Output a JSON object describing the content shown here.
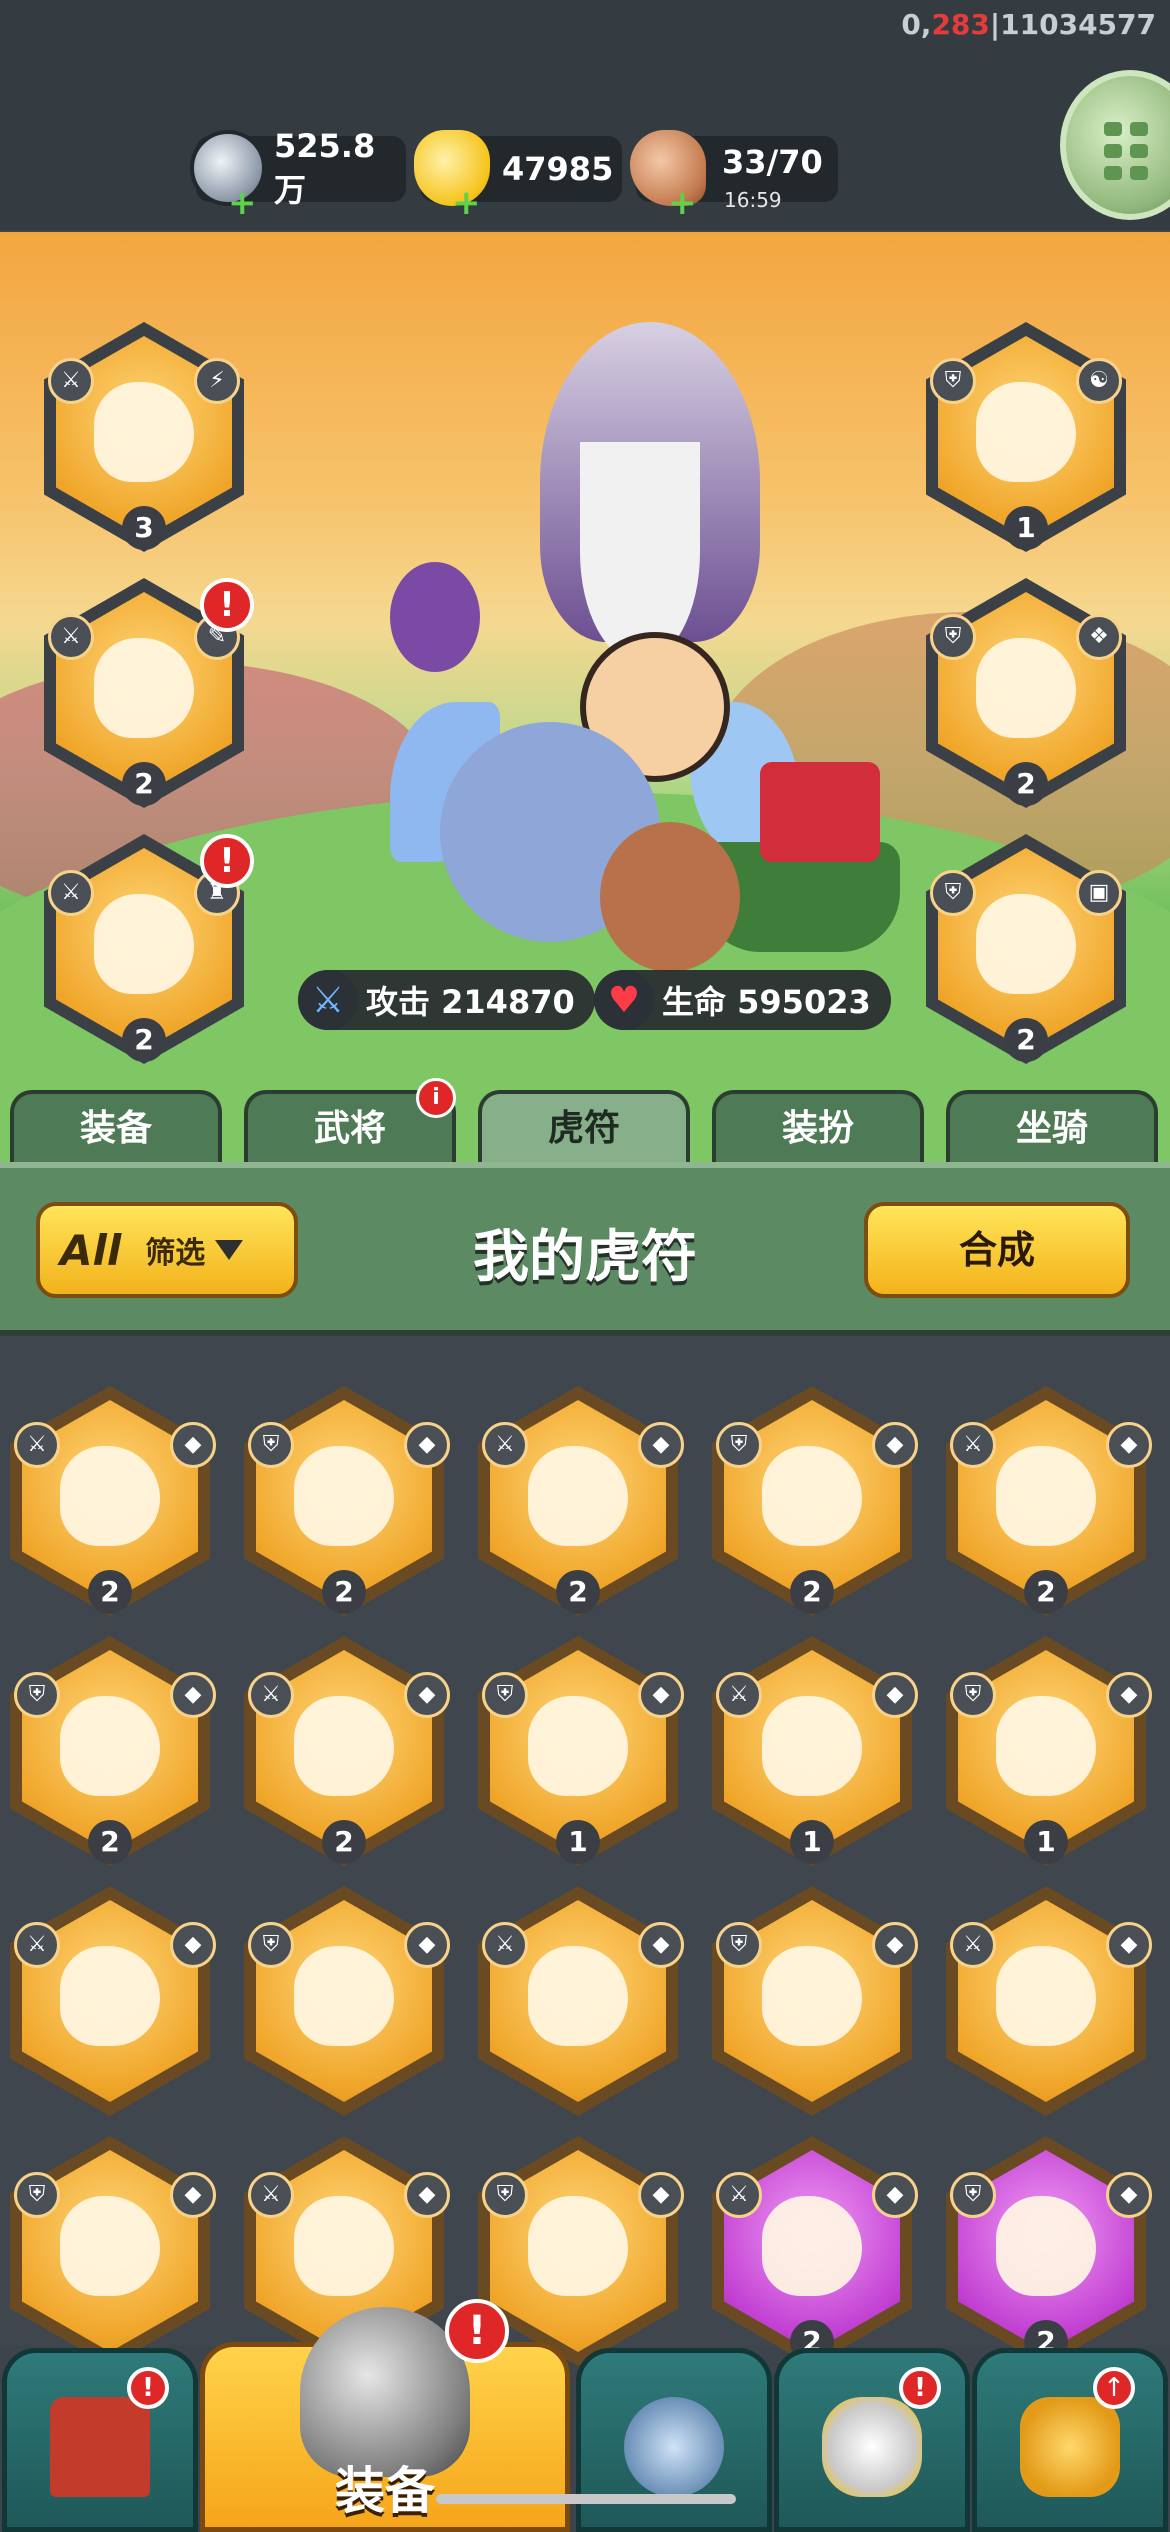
{
  "debug": {
    "prefix": "0,",
    "red": "283",
    "suffix": "|11034577"
  },
  "resources": {
    "silver": {
      "value": "525.8万",
      "icon": "silver-coin-icon"
    },
    "gold": {
      "value": "47985",
      "icon": "gold-ingot-icon"
    },
    "stamina": {
      "value": "33/70",
      "timer": "16:59",
      "icon": "meat-drumstick-icon"
    }
  },
  "stats": {
    "attack": "攻击 214870",
    "hp": "生命 595023"
  },
  "equipped_left": [
    {
      "level": "3",
      "alert": false
    },
    {
      "level": "2",
      "alert": true
    },
    {
      "level": "2",
      "alert": true
    }
  ],
  "equipped_right": [
    {
      "level": "1"
    },
    {
      "level": "2"
    },
    {
      "level": "2"
    }
  ],
  "tabs": [
    {
      "label": "装备",
      "active": false
    },
    {
      "label": "武将",
      "active": false,
      "badge": "i"
    },
    {
      "label": "虎符",
      "active": true
    },
    {
      "label": "装扮",
      "active": false
    },
    {
      "label": "坐骑",
      "active": false
    }
  ],
  "panel": {
    "filter_all": "All",
    "filter_label": "筛选",
    "title": "我的虎符",
    "merge_label": "合成"
  },
  "tallies": [
    {
      "level": "2",
      "color": "gold"
    },
    {
      "level": "2",
      "color": "gold"
    },
    {
      "level": "2",
      "color": "gold"
    },
    {
      "level": "2",
      "color": "gold"
    },
    {
      "level": "2",
      "color": "gold"
    },
    {
      "level": "2",
      "color": "gold"
    },
    {
      "level": "2",
      "color": "gold"
    },
    {
      "level": "1",
      "color": "gold"
    },
    {
      "level": "1",
      "color": "gold"
    },
    {
      "level": "1",
      "color": "gold"
    },
    {
      "level": "",
      "color": "gold"
    },
    {
      "level": "",
      "color": "gold"
    },
    {
      "level": "",
      "color": "gold"
    },
    {
      "level": "",
      "color": "gold"
    },
    {
      "level": "",
      "color": "gold"
    },
    {
      "level": "",
      "color": "gold"
    },
    {
      "level": "",
      "color": "gold"
    },
    {
      "level": "",
      "color": "gold"
    },
    {
      "level": "2",
      "color": "purple"
    },
    {
      "level": "2",
      "color": "purple"
    }
  ],
  "bottom_nav": [
    {
      "label": "",
      "icon": "shop-gate-icon",
      "alert": true
    },
    {
      "label": "装备",
      "icon": "helmet-icon",
      "alert": true,
      "active": true
    },
    {
      "label": "",
      "icon": "battle-swords-icon",
      "alert": false
    },
    {
      "label": "",
      "icon": "horn-stars-icon",
      "alert": true
    },
    {
      "label": "",
      "icon": "upgrade-fist-icon",
      "alert": false
    }
  ],
  "colors": {
    "accent_gold": "#f2b21b",
    "panel_green": "#5b8a63",
    "alert_red": "#e02727",
    "rare_purple": "#c13fd2"
  }
}
